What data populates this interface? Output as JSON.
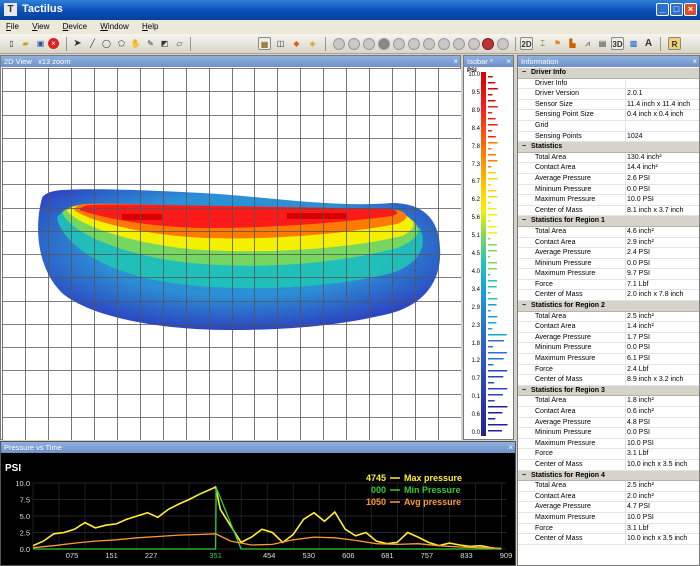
{
  "window": {
    "title": "Tactilus",
    "icon": "tactilus-logo-icon",
    "controls": [
      "minimize-icon",
      "maximize-icon",
      "close-icon"
    ]
  },
  "menu": [
    "File",
    "View",
    "Device",
    "Window",
    "Help"
  ],
  "toolbar": {
    "file_tools": [
      "new-icon",
      "open-icon",
      "save-icon",
      "stop-icon"
    ],
    "draw_tools": [
      "pointer-icon",
      "pencil-icon",
      "ellipse-icon",
      "polygon-icon",
      "hand-icon",
      "pen-icon",
      "select-region-icon",
      "eraser-icon"
    ],
    "view_tools": [
      "grid-icon",
      "palette-icon",
      "map-icon",
      "layers-icon"
    ],
    "playback_tools": [
      "first-frame-icon",
      "rewind-icon",
      "step-back-icon",
      "stop-play-icon",
      "play-icon",
      "step-forward-icon",
      "fast-forward-icon",
      "last-frame-icon",
      "pause-icon",
      "loop-icon",
      "record-icon",
      "snapshot-icon"
    ],
    "mode_tools": [
      {
        "label": "2D",
        "icon": "view-2d-icon"
      },
      {
        "label": "",
        "icon": "calibrate-icon"
      },
      {
        "label": "",
        "icon": "flag-icon"
      },
      {
        "label": "",
        "icon": "peak-icon"
      },
      {
        "label": "",
        "icon": "chart-icon"
      },
      {
        "label": "",
        "icon": "report-icon"
      },
      {
        "label": "3D",
        "icon": "view-3d-icon"
      },
      {
        "label": "",
        "icon": "contour-icon"
      },
      {
        "label": "A",
        "icon": "text-icon"
      },
      {
        "label": "R",
        "icon": "record-mode-icon"
      }
    ]
  },
  "view2d": {
    "title": "2D View",
    "zoom": "x13 zoom",
    "grid_cols": 20,
    "grid_rows": 16
  },
  "isobar": {
    "title": "Isobar *",
    "unit": "PSI",
    "labels": [
      "10.0",
      "9.5",
      "8.9",
      "8.4",
      "7.8",
      "7.3",
      "6.7",
      "6.2",
      "5.6",
      "5.1",
      "4.5",
      "4.0",
      "3.4",
      "2.9",
      "2.3",
      "1.8",
      "1.2",
      "0.7",
      "0.1",
      "0.6",
      "0.0"
    ]
  },
  "info": {
    "title": "Information",
    "sections": [
      {
        "name": "Driver Info",
        "rows": [
          [
            "Driver Info",
            ""
          ],
          [
            "Driver Version",
            "2.0.1"
          ],
          [
            "Sensor Size",
            "11.4 inch x 11.4 inch"
          ],
          [
            "Sensing Point Size",
            "0.4 inch x 0.4 inch"
          ],
          [
            "Grid",
            ""
          ],
          [
            "Sensing Points",
            "1024"
          ]
        ]
      },
      {
        "name": "Statistics",
        "rows": [
          [
            "Total Area",
            "130.4 inch²"
          ],
          [
            "Contact Area",
            "14.4 inch²"
          ],
          [
            "Average Pressure",
            "2.6 PSI"
          ],
          [
            "Mininum Pressure",
            "0.0 PSI"
          ],
          [
            "Maximum Pressure",
            "10.0 PSI"
          ],
          [
            "Center of Mass",
            "8.1 inch x 3.7 inch"
          ]
        ]
      },
      {
        "name": "Statistics for Region 1",
        "rows": [
          [
            "Total Area",
            "4.6 inch²"
          ],
          [
            "Contact Area",
            "2.9 inch²"
          ],
          [
            "Average Pressure",
            "2.4 PSI"
          ],
          [
            "Mininum Pressure",
            "0.0 PSI"
          ],
          [
            "Maximum Pressure",
            "9.7 PSI"
          ],
          [
            "Force",
            "7.1 Lbf"
          ],
          [
            "Center of Mass",
            "2.0 inch x 7.8 inch"
          ]
        ]
      },
      {
        "name": "Statistics for Region 2",
        "rows": [
          [
            "Total Area",
            "2.5 inch²"
          ],
          [
            "Contact Area",
            "1.4 inch²"
          ],
          [
            "Average Pressure",
            "1.7 PSI"
          ],
          [
            "Mininum Pressure",
            "0.0 PSI"
          ],
          [
            "Maximum Pressure",
            "6.1 PSI"
          ],
          [
            "Force",
            "2.4 Lbf"
          ],
          [
            "Center of Mass",
            "8.9 inch x 3.2 inch"
          ]
        ]
      },
      {
        "name": "Statistics for Region 3",
        "rows": [
          [
            "Total Area",
            "1.8 inch²"
          ],
          [
            "Contact Area",
            "0.6 inch²"
          ],
          [
            "Average Pressure",
            "4.8 PSI"
          ],
          [
            "Mininum Pressure",
            "0.0 PSI"
          ],
          [
            "Maximum Pressure",
            "10.0 PSI"
          ],
          [
            "Force",
            "3.1 Lbf"
          ],
          [
            "Center of Mass",
            "10.0 inch x 3.5 inch"
          ]
        ]
      },
      {
        "name": "Statistics for Region 4",
        "rows": [
          [
            "Total Area",
            "2.5 inch²"
          ],
          [
            "Contact Area",
            "2.0 inch²"
          ],
          [
            "Average Pressure",
            "4.7 PSI"
          ],
          [
            "Maximum Pressure",
            "10.0 PSI"
          ],
          [
            "Force",
            "3.1 Lbf"
          ],
          [
            "Center of Mass",
            "10.0 inch x 3.5 inch"
          ]
        ]
      }
    ]
  },
  "pvt": {
    "title": "Pressure vs Time",
    "legend": [
      {
        "value": "4745",
        "label": "Max pressure",
        "color": "#ffee33"
      },
      {
        "value": "000",
        "label": "Min Pressure",
        "color": "#33cc33"
      },
      {
        "value": "1050",
        "label": "Avg pressure",
        "color": "#ff9933"
      }
    ]
  },
  "chart_data": {
    "type": "line",
    "title": "",
    "ylabel": "PSI",
    "xlabel": "",
    "ylim": [
      0,
      10
    ],
    "xlim": [
      0,
      909
    ],
    "yticks": [
      "0.0",
      "2.5",
      "5.0",
      "7.5",
      "10.0"
    ],
    "xticks": [
      "075",
      "151",
      "227",
      "351",
      "454",
      "530",
      "606",
      "681",
      "757",
      "833",
      "909"
    ],
    "highlight_tick": "351",
    "series": [
      {
        "name": "Max pressure",
        "color": "#ffee33",
        "x": [
          0,
          20,
          40,
          60,
          80,
          100,
          120,
          140,
          160,
          180,
          200,
          220,
          240,
          260,
          280,
          300,
          320,
          340,
          351,
          360,
          380,
          400,
          420,
          440,
          460,
          480,
          500,
          520,
          540,
          560,
          580,
          600,
          620,
          640,
          660,
          680,
          700,
          720,
          740,
          760,
          780,
          800,
          820,
          840,
          860,
          880,
          900
        ],
        "y": [
          0.5,
          1.2,
          2.3,
          2.5,
          3.0,
          4.0,
          3.2,
          3.6,
          3.8,
          4.5,
          5.0,
          5.5,
          4.8,
          6.0,
          6.8,
          7.5,
          8.3,
          9.0,
          9.4,
          6.0,
          3.5,
          1.0,
          1.8,
          3.0,
          2.5,
          1.0,
          2.2,
          4.5,
          5.5,
          4.2,
          5.6,
          3.0,
          2.0,
          2.5,
          1.2,
          0.8,
          1.0,
          2.5,
          1.8,
          1.0,
          0.5,
          0.9,
          0.6,
          0.4,
          0.5,
          0.2,
          0.0
        ]
      },
      {
        "name": "Min Pressure",
        "color": "#33cc33",
        "x": [
          0,
          100,
          200,
          300,
          351,
          352,
          400,
          500,
          600,
          700,
          800,
          900
        ],
        "y": [
          0.0,
          0.0,
          0.0,
          0.0,
          0.0,
          9.3,
          0.0,
          0.0,
          0.0,
          0.0,
          0.0,
          0.0
        ]
      },
      {
        "name": "Avg pressure",
        "color": "#ff9933",
        "x": [
          0,
          40,
          80,
          120,
          160,
          200,
          240,
          280,
          320,
          351,
          380,
          420,
          460,
          500,
          540,
          580,
          620,
          660,
          700,
          740,
          780,
          820,
          860,
          900
        ],
        "y": [
          0.2,
          0.5,
          0.9,
          1.2,
          1.4,
          1.7,
          1.9,
          2.1,
          2.2,
          2.3,
          1.2,
          0.6,
          0.7,
          1.4,
          1.8,
          1.7,
          1.3,
          0.8,
          0.7,
          0.8,
          0.5,
          0.3,
          0.2,
          0.1
        ]
      }
    ],
    "grid": true
  },
  "colors": {
    "title_bar": "#0a4fb8",
    "panel_header": "#7b9bd0",
    "chart_bg": "#000000",
    "grid_line": "#333333",
    "pressure_scale": [
      "#21209a",
      "#2c45c2",
      "#2c6fd6",
      "#19a2d8",
      "#20c7b5",
      "#7ed957",
      "#f5f000",
      "#ffd400",
      "#ff7a00",
      "#ff1a1a",
      "#d70000"
    ]
  }
}
